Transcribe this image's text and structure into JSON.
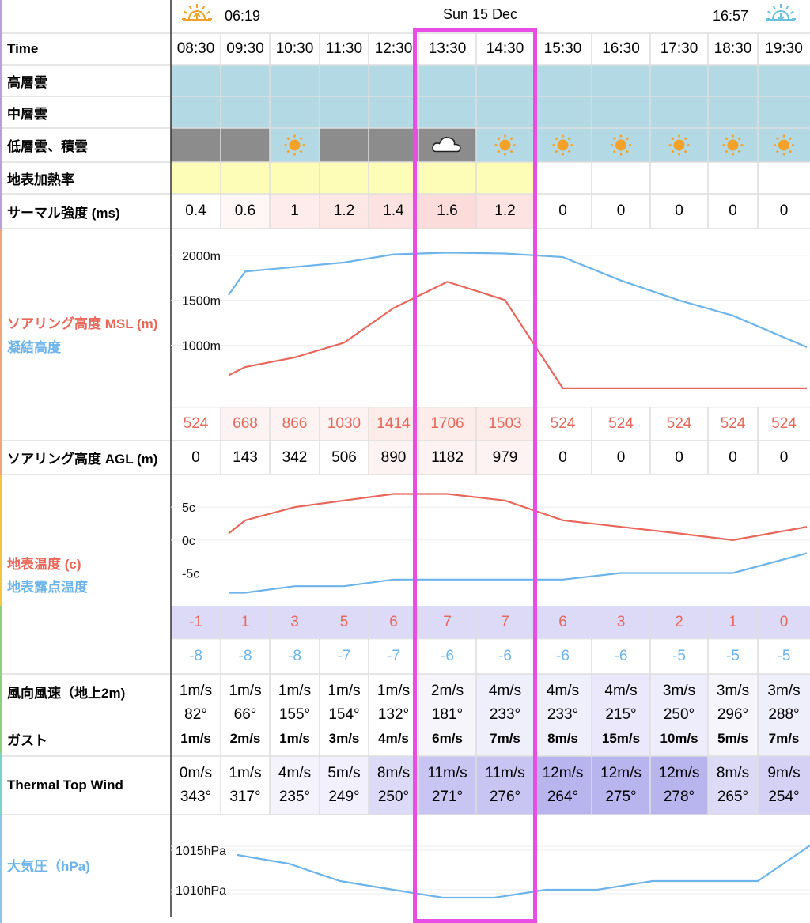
{
  "header": {
    "date": "Sun 15 Dec",
    "sunrise": "06:19",
    "sunset": "16:57"
  },
  "rows": {
    "time": "Time",
    "high_cloud": "高層雲",
    "mid_cloud": "中層雲",
    "low_cloud": "低層雲、積雲",
    "surface_heating": "地表加熱率",
    "thermal_strength": "サーマル強度 (ms)",
    "soaring_msl": "ソアリング高度 MSL (m)",
    "cloud_base": "凝結高度",
    "soaring_agl": "ソアリング高度 AGL (m)",
    "surface_temp": "地表温度 (c)",
    "dew_point": "地表露点温度",
    "wind": "風向風速（地上2m)",
    "gust": "ガスト",
    "thermal_top_wind": "Thermal Top Wind",
    "pressure": "大気圧（hPa)"
  },
  "times": [
    "08:30",
    "09:30",
    "10:30",
    "11:30",
    "12:30",
    "13:30",
    "14:30",
    "15:30",
    "16:30",
    "17:30",
    "18:30",
    "19:30"
  ],
  "low_cloud_icons": [
    "overcast",
    "overcast",
    "sun-icon",
    "overcast",
    "overcast",
    "cloud-icon",
    "sun-icon",
    "sun-icon",
    "sun-icon",
    "sun-icon",
    "sun-icon",
    "sun-icon"
  ],
  "thermal_strength": [
    "0.4",
    "0.6",
    "1",
    "1.2",
    "1.4",
    "1.6",
    "1.2",
    "0",
    "0",
    "0",
    "0",
    "0"
  ],
  "soaring_msl_values": [
    "524",
    "668",
    "866",
    "1030",
    "1414",
    "1706",
    "1503",
    "524",
    "524",
    "524",
    "524",
    "524"
  ],
  "soaring_agl_values": [
    "0",
    "143",
    "342",
    "506",
    "890",
    "1182",
    "979",
    "0",
    "0",
    "0",
    "0",
    "0"
  ],
  "temp_values": [
    "-1",
    "1",
    "3",
    "5",
    "6",
    "7",
    "7",
    "6",
    "3",
    "2",
    "1",
    "0"
  ],
  "dew_values": [
    "-8",
    "-8",
    "-8",
    "-7",
    "-7",
    "-6",
    "-6",
    "-6",
    "-6",
    "-5",
    "-5",
    "-5"
  ],
  "wind": [
    {
      "speed": "1m/s",
      "dir": "82°",
      "gust": "1m/s"
    },
    {
      "speed": "1m/s",
      "dir": "66°",
      "gust": "2m/s"
    },
    {
      "speed": "1m/s",
      "dir": "155°",
      "gust": "1m/s"
    },
    {
      "speed": "1m/s",
      "dir": "154°",
      "gust": "3m/s"
    },
    {
      "speed": "1m/s",
      "dir": "132°",
      "gust": "4m/s"
    },
    {
      "speed": "2m/s",
      "dir": "181°",
      "gust": "6m/s"
    },
    {
      "speed": "4m/s",
      "dir": "233°",
      "gust": "7m/s"
    },
    {
      "speed": "4m/s",
      "dir": "233°",
      "gust": "8m/s"
    },
    {
      "speed": "4m/s",
      "dir": "215°",
      "gust": "15m/s"
    },
    {
      "speed": "3m/s",
      "dir": "250°",
      "gust": "10m/s"
    },
    {
      "speed": "3m/s",
      "dir": "296°",
      "gust": "5m/s"
    },
    {
      "speed": "3m/s",
      "dir": "288°",
      "gust": "7m/s"
    }
  ],
  "thermal_top_wind": [
    {
      "speed": "0m/s",
      "dir": "343°"
    },
    {
      "speed": "1m/s",
      "dir": "317°"
    },
    {
      "speed": "4m/s",
      "dir": "235°"
    },
    {
      "speed": "5m/s",
      "dir": "249°"
    },
    {
      "speed": "8m/s",
      "dir": "250°"
    },
    {
      "speed": "11m/s",
      "dir": "271°"
    },
    {
      "speed": "11m/s",
      "dir": "276°"
    },
    {
      "speed": "12m/s",
      "dir": "264°"
    },
    {
      "speed": "12m/s",
      "dir": "275°"
    },
    {
      "speed": "12m/s",
      "dir": "278°"
    },
    {
      "speed": "8m/s",
      "dir": "265°"
    },
    {
      "speed": "9m/s",
      "dir": "254°"
    }
  ],
  "chart_data": [
    {
      "type": "line",
      "x": [
        "08:30",
        "09:30",
        "10:30",
        "11:30",
        "12:30",
        "13:30",
        "14:30",
        "15:30",
        "16:30",
        "17:30",
        "18:30",
        "19:30"
      ],
      "series": [
        {
          "name": "ソアリング高度 MSL (m)",
          "color": "#e8675a",
          "values": [
            668,
            760,
            866,
            1030,
            1414,
            1706,
            1503,
            524,
            524,
            524,
            524,
            524
          ]
        },
        {
          "name": "凝結高度",
          "color": "#6cb4ea",
          "values": [
            1560,
            1820,
            1870,
            1920,
            2010,
            2030,
            2020,
            1980,
            1720,
            1500,
            1330,
            980
          ]
        }
      ],
      "y_ticks": [
        "2000m",
        "1500m",
        "1000m"
      ],
      "y_tick_values": [
        2000,
        1500,
        1000
      ],
      "ylim": [
        400,
        2200
      ]
    },
    {
      "type": "line",
      "x": [
        "08:30",
        "09:30",
        "10:30",
        "11:30",
        "12:30",
        "13:30",
        "14:30",
        "15:30",
        "16:30",
        "17:30",
        "18:30",
        "19:30"
      ],
      "series": [
        {
          "name": "地表温度 (c)",
          "color": "#e8675a",
          "values": [
            1,
            3,
            5,
            6,
            7,
            7,
            6,
            3,
            2,
            1,
            0,
            2
          ]
        },
        {
          "name": "地表露点温度",
          "color": "#6cb4ea",
          "values": [
            -8,
            -8,
            -7,
            -7,
            -6,
            -6,
            -6,
            -6,
            -5,
            -5,
            -5,
            -2
          ]
        }
      ],
      "y_ticks": [
        "5c",
        "0c",
        "-5c"
      ],
      "y_tick_values": [
        5,
        0,
        -5
      ],
      "ylim": [
        -9.5,
        8.5
      ]
    },
    {
      "type": "line",
      "x": [
        "08:30",
        "09:30",
        "10:30",
        "11:30",
        "12:30",
        "13:30",
        "14:30",
        "15:30",
        "16:30",
        "17:30",
        "18:30",
        "19:30"
      ],
      "series": [
        {
          "name": "大気圧（hPa)",
          "color": "#6cb4ea",
          "values": [
            1014.4,
            1013.3,
            1011.1,
            1010.0,
            1009.0,
            1009.0,
            1010.0,
            1010.0,
            1011.1,
            1011.1,
            1011.1,
            1015.6
          ]
        }
      ],
      "y_ticks": [
        "1015hPa",
        "1010hPa"
      ],
      "y_tick_values": [
        1015,
        1010
      ],
      "ylim": [
        1006.5,
        1017.5
      ]
    }
  ],
  "colors": {
    "temp": "#e8675a",
    "dew": "#6cb4ea",
    "highlight": "#e84ee6",
    "cloud_blue": "#b3dae4",
    "overcast": "#8c8c8c",
    "heating": "#fefdb7",
    "sun": "#f4a12a"
  }
}
